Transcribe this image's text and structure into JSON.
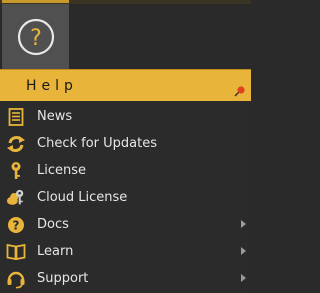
{
  "colors": {
    "accent": "#e9b43a",
    "icon": "#e8b53a",
    "text": "#e6e6e6",
    "background": "#2b2b2b"
  },
  "help_button": {
    "icon": "question-circle-icon",
    "glyph": "?"
  },
  "menu": {
    "header": {
      "title": "Help",
      "pin_icon": "pin-icon"
    },
    "items": [
      {
        "label": "News",
        "icon": "news-icon",
        "submenu": false
      },
      {
        "label": "Check for Updates",
        "icon": "refresh-icon",
        "submenu": false
      },
      {
        "label": "License",
        "icon": "key-icon",
        "submenu": false
      },
      {
        "label": "Cloud License",
        "icon": "cloud-key-icon",
        "submenu": false
      },
      {
        "label": "Docs",
        "icon": "question-icon",
        "submenu": true
      },
      {
        "label": "Learn",
        "icon": "book-icon",
        "submenu": true
      },
      {
        "label": "Support",
        "icon": "headset-icon",
        "submenu": true
      }
    ]
  }
}
